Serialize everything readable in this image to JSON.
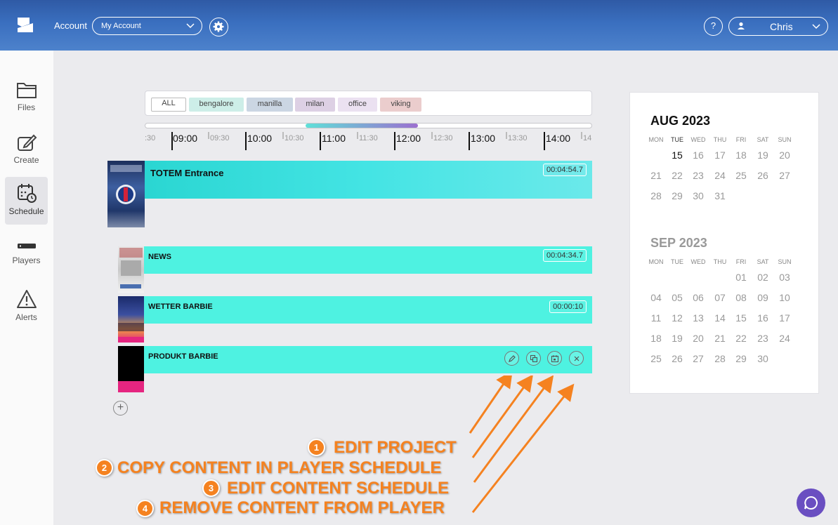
{
  "header": {
    "account_label": "Account",
    "account_value": "My Account",
    "help_label": "?",
    "user_name": "Chris"
  },
  "sidebar": {
    "items": [
      {
        "label": "Files",
        "icon": "folder-icon"
      },
      {
        "label": "Create",
        "icon": "edit-icon"
      },
      {
        "label": "Schedule",
        "icon": "calendar-clock-icon",
        "active": true
      },
      {
        "label": "Players",
        "icon": "player-icon"
      },
      {
        "label": "Alerts",
        "icon": "alert-icon"
      }
    ]
  },
  "filters": {
    "chips": [
      {
        "label": "ALL",
        "color": "#ffffff"
      },
      {
        "label": "bengalore",
        "color": "#cdeee8"
      },
      {
        "label": "manilla",
        "color": "#cbd6e3"
      },
      {
        "label": "milan",
        "color": "#ddd0e4"
      },
      {
        "label": "office",
        "color": "#ebe1f1"
      },
      {
        "label": "viking",
        "color": "#ebcdcd"
      }
    ]
  },
  "timeline": {
    "labels": [
      ":30",
      "09:00",
      "09:30",
      "10:00",
      "10:30",
      "11:00",
      "11:30",
      "12:00",
      "12:30",
      "13:00",
      "13:30",
      "14:00",
      "14"
    ]
  },
  "schedule": {
    "main": {
      "title": "TOTEM Entrance",
      "duration": "00:04:54.7"
    },
    "items": [
      {
        "title": "NEWS",
        "duration": "00:04:34.7"
      },
      {
        "title": "WETTER BARBIE",
        "duration": "00:00:10"
      },
      {
        "title": "PRODUKT BARBIE",
        "duration": ""
      }
    ],
    "add_label": "+"
  },
  "calendar": {
    "dow": [
      "MON",
      "TUE",
      "WED",
      "THU",
      "FRI",
      "SAT",
      "SUN"
    ],
    "months": [
      {
        "title": "AUG 2023",
        "weeks": [
          [
            "",
            "15",
            "16",
            "17",
            "18",
            "19",
            "20"
          ],
          [
            "21",
            "22",
            "23",
            "24",
            "25",
            "26",
            "27"
          ],
          [
            "28",
            "29",
            "30",
            "31",
            "",
            "",
            ""
          ]
        ],
        "today": "15"
      },
      {
        "title": "SEP 2023",
        "weeks": [
          [
            "",
            "",
            "",
            "",
            "01",
            "02",
            "03"
          ],
          [
            "04",
            "05",
            "06",
            "07",
            "08",
            "09",
            "10"
          ],
          [
            "11",
            "12",
            "13",
            "14",
            "15",
            "16",
            "17"
          ],
          [
            "18",
            "19",
            "20",
            "21",
            "22",
            "23",
            "24"
          ],
          [
            "25",
            "26",
            "27",
            "28",
            "29",
            "30",
            ""
          ]
        ]
      }
    ]
  },
  "annotations": [
    {
      "num": "1",
      "text": "EDIT PROJECT"
    },
    {
      "num": "2",
      "text": "COPY CONTENT IN PLAYER SCHEDULE"
    },
    {
      "num": "3",
      "text": "EDIT CONTENT SCHEDULE"
    },
    {
      "num": "4",
      "text": "REMOVE CONTENT FROM PLAYER"
    }
  ],
  "colors": {
    "accent": "#4ef2e1",
    "annotation": "#f58220",
    "chat": "#6a4fc1"
  }
}
